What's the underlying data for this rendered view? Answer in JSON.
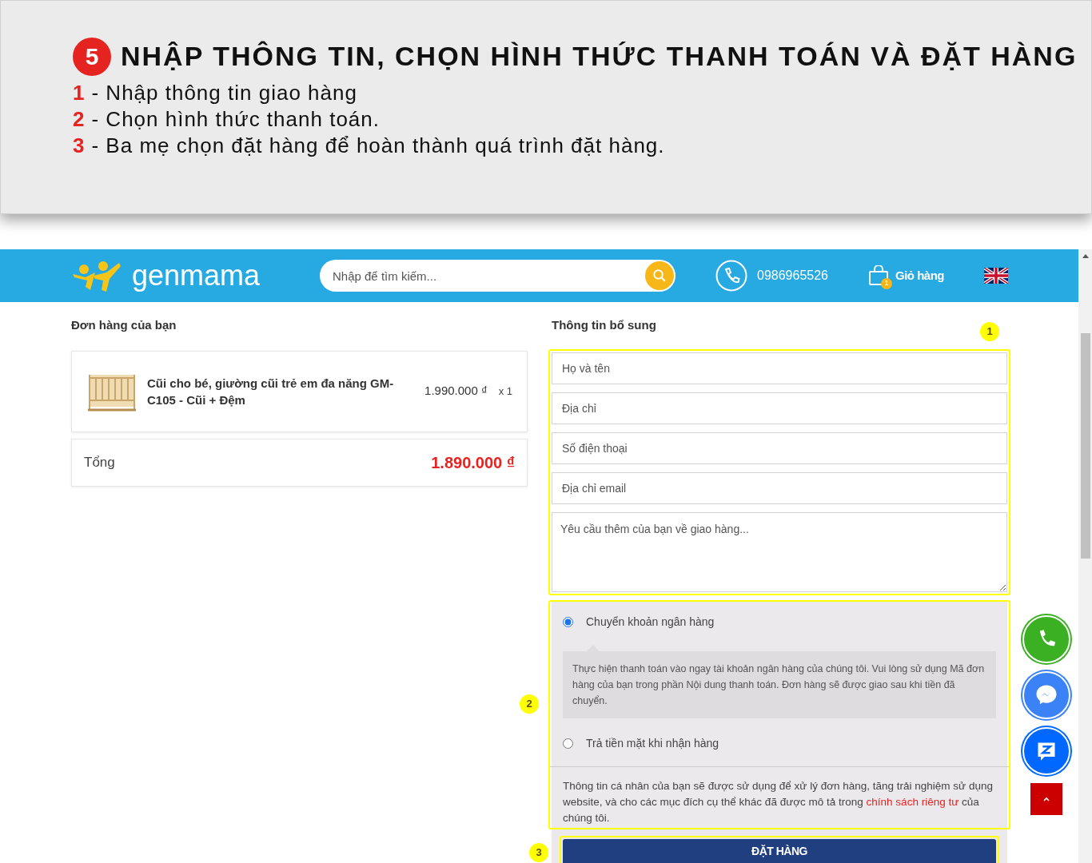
{
  "banner": {
    "step_number": "5",
    "title": "NHẬP THÔNG TIN, CHỌN HÌNH THỨC THANH TOÁN VÀ ĐẶT HÀNG",
    "steps": [
      {
        "number": "1",
        "text": "- Nhập thông tin giao hàng"
      },
      {
        "number": "2",
        "text": "- Chọn hình thức thanh toán."
      },
      {
        "number": "3",
        "text": "- Ba mẹ chọn đặt hàng để hoàn thành quá trình đặt hàng."
      }
    ]
  },
  "header": {
    "logo": "genmama",
    "search": {
      "placeholder": "Nhập để tìm kiếm..."
    },
    "phone": "0986965526",
    "cart": {
      "label": "Giỏ hàng",
      "count": "1"
    }
  },
  "order": {
    "title": "Đơn hàng của bạn",
    "items": [
      {
        "name": "Cũi cho bé, giường cũi trẻ em đa năng GM-C105 - Cũi + Đệm",
        "price": "1.990.000 ₫",
        "quantity": "x 1"
      }
    ],
    "total_label": "Tổng",
    "total": "1.890.000 ₫"
  },
  "checkout": {
    "title": "Thông tin bổ sung",
    "fields": [
      {
        "kind": "input",
        "placeholder": "Họ và tên"
      },
      {
        "kind": "input",
        "placeholder": "Địa chỉ"
      },
      {
        "kind": "input",
        "placeholder": "Số điện thoại"
      },
      {
        "kind": "input",
        "placeholder": "Địa chỉ email"
      },
      {
        "kind": "textarea",
        "placeholder": "Yêu cầu thêm của bạn về giao hàng..."
      }
    ],
    "payment_methods": [
      {
        "label": "Chuyển khoản ngân hàng",
        "selected": true,
        "description": "Thực hiện thanh toán vào ngay tài khoản ngân hàng của chúng tôi. Vui lòng sử dụng Mã đơn hàng của bạn trong phần Nội dung thanh toán. Đơn hàng sẽ được giao sau khi tiền đã chuyển."
      },
      {
        "label": "Trả tiền mặt khi nhận hàng",
        "selected": false
      }
    ],
    "privacy_text": "Thông tin cá nhân của bạn sẽ được sử dụng để xử lý đơn hàng, tăng trải nghiệm sử dụng website, và cho các mục đích cụ thể khác đã được mô tả trong",
    "privacy_link": "chính sách riêng tư",
    "privacy_end": "của chúng tôi.",
    "submit": "ĐẶT HÀNG",
    "markers": [
      "1",
      "2",
      "3"
    ]
  }
}
